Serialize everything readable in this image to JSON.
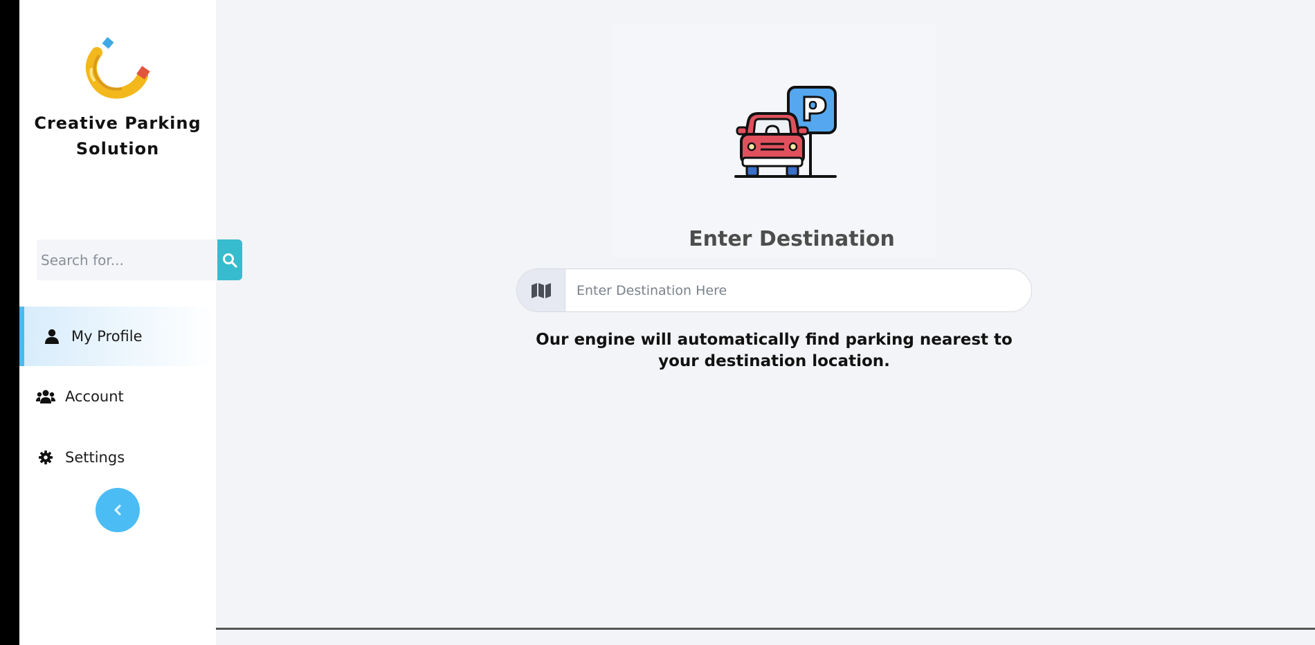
{
  "brand": {
    "name": "Creative Parking Solution",
    "logo_icon": "magnet-logo-icon"
  },
  "sidebar": {
    "search": {
      "placeholder": "Search for...",
      "button_icon": "search-icon"
    },
    "items": [
      {
        "label": "My Profile",
        "icon": "user-icon",
        "active": true
      },
      {
        "label": "Account",
        "icon": "users-icon",
        "active": false
      },
      {
        "label": "Settings",
        "icon": "gear-icon",
        "active": false
      }
    ],
    "collapse_icon": "chevron-left-icon"
  },
  "main": {
    "hero_icon": "car-parking-icon",
    "title": "Enter Destination",
    "destination": {
      "addon_icon": "map-icon",
      "placeholder": "Enter Destination Here",
      "value": ""
    },
    "helper_text": "Our engine will automatically find parking nearest to your destination location."
  },
  "colors": {
    "accent": "#36bccd",
    "collapse": "#4bbcf4",
    "active_border": "#4bb9ef",
    "background": "#f3f4f7"
  }
}
